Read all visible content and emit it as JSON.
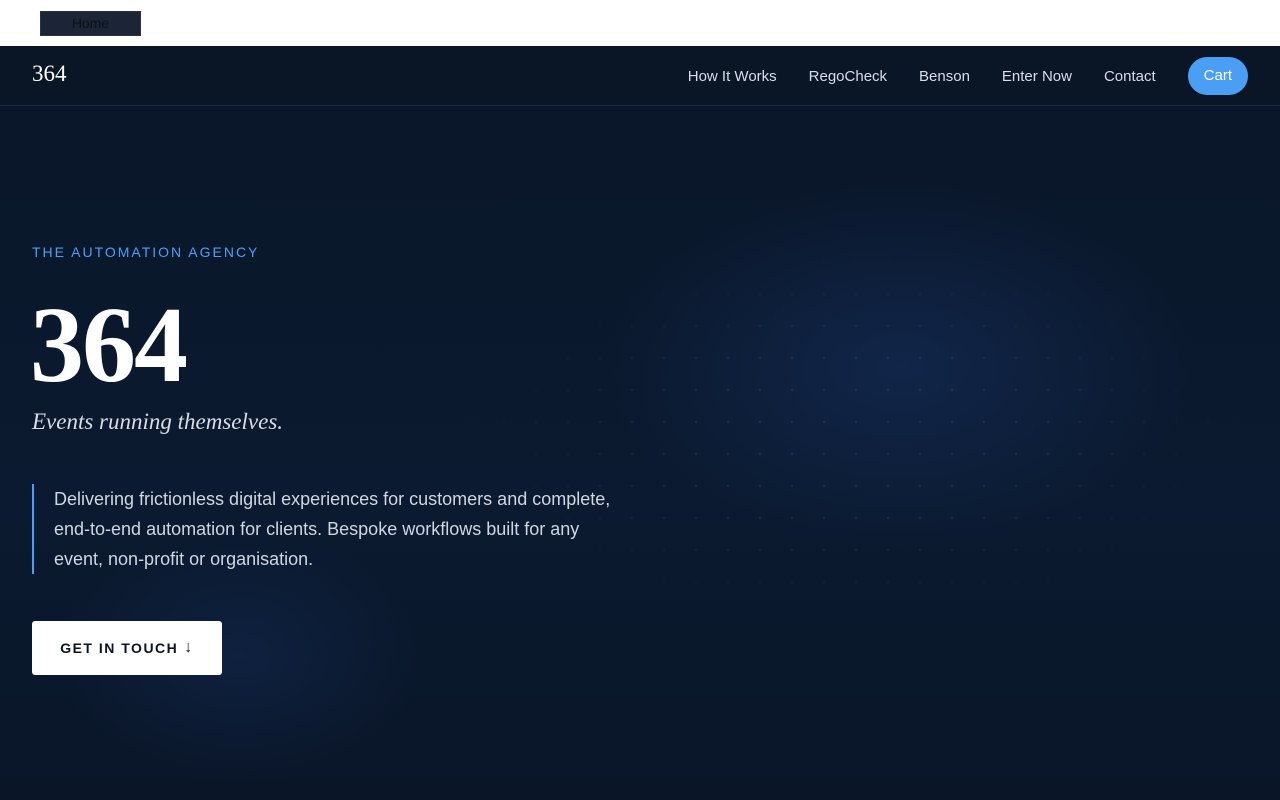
{
  "topbar": {
    "home_label": "Home"
  },
  "navbar": {
    "brand": "364",
    "links": [
      "How It Works",
      "RegoCheck",
      "Benson",
      "Enter Now",
      "Contact"
    ],
    "cart_label": "Cart"
  },
  "hero": {
    "eyebrow": "THE AUTOMATION AGENCY",
    "title": "364",
    "tagline": "Events running themselves.",
    "description": "Delivering frictionless digital experiences for customers and complete, end-to-end automation for clients. Bespoke workflows built for any event, non-profit or organisation.",
    "cta_label": "GET IN TOUCH",
    "cta_icon": "arrow-down-icon",
    "cta_glyph": "↓"
  },
  "colors": {
    "background": "#0a1628",
    "accent": "#4a9ff5",
    "text": "#ffffff"
  }
}
